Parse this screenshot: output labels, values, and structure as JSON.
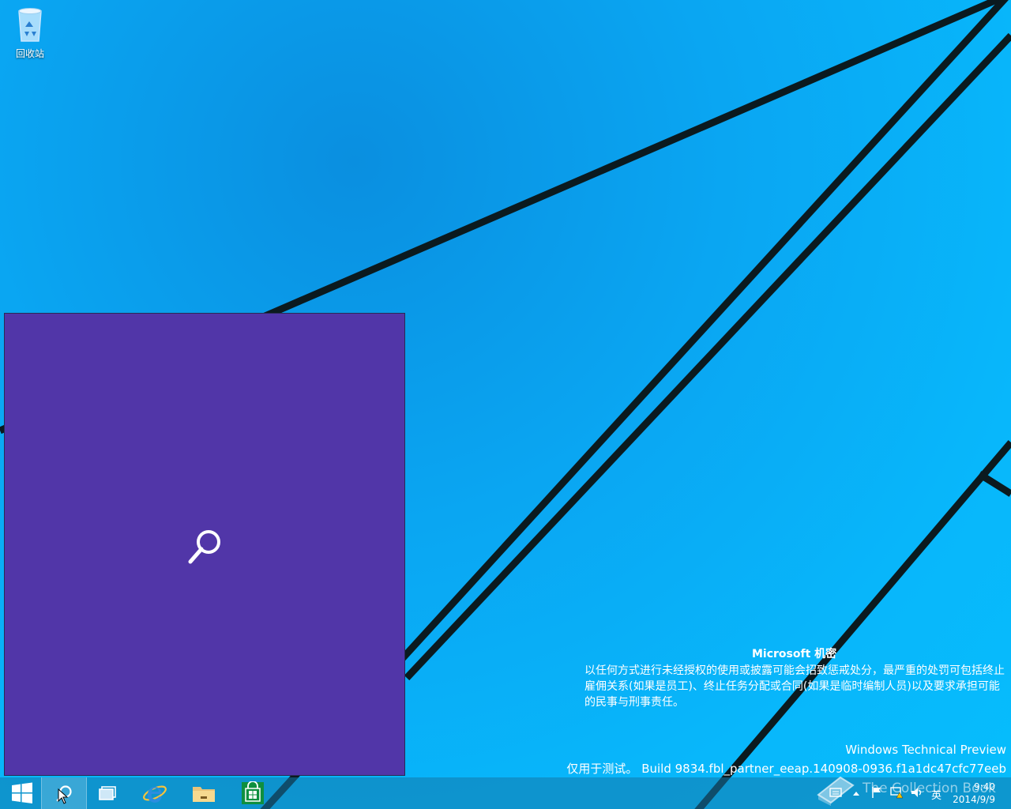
{
  "desktop": {
    "recycle_bin_label": "回收站"
  },
  "watermark": {
    "title": "Microsoft 机密",
    "body": "以任何方式进行未经授权的使用或披露可能会招致惩戒处分，最严重的处罚可包括终止雇佣关系(如果是员工)、终止任务分配或合同(如果是临时编制人员)以及要求承担可能的民事与刑事责任。",
    "edition": "Windows Technical Preview",
    "build": "仅用于测试。 Build 9834.fbl_partner_eeap.140908-0936.f1a1dc47cfc77eeb"
  },
  "overlay": {
    "brand_text": "The Collection Book"
  },
  "tray": {
    "ime": "英",
    "time": "9:40",
    "date": "2014/9/9"
  },
  "colors": {
    "search_panel": "#5136a8",
    "store_green": "#0f8f3f",
    "wallpaper": "#08b7fb"
  }
}
